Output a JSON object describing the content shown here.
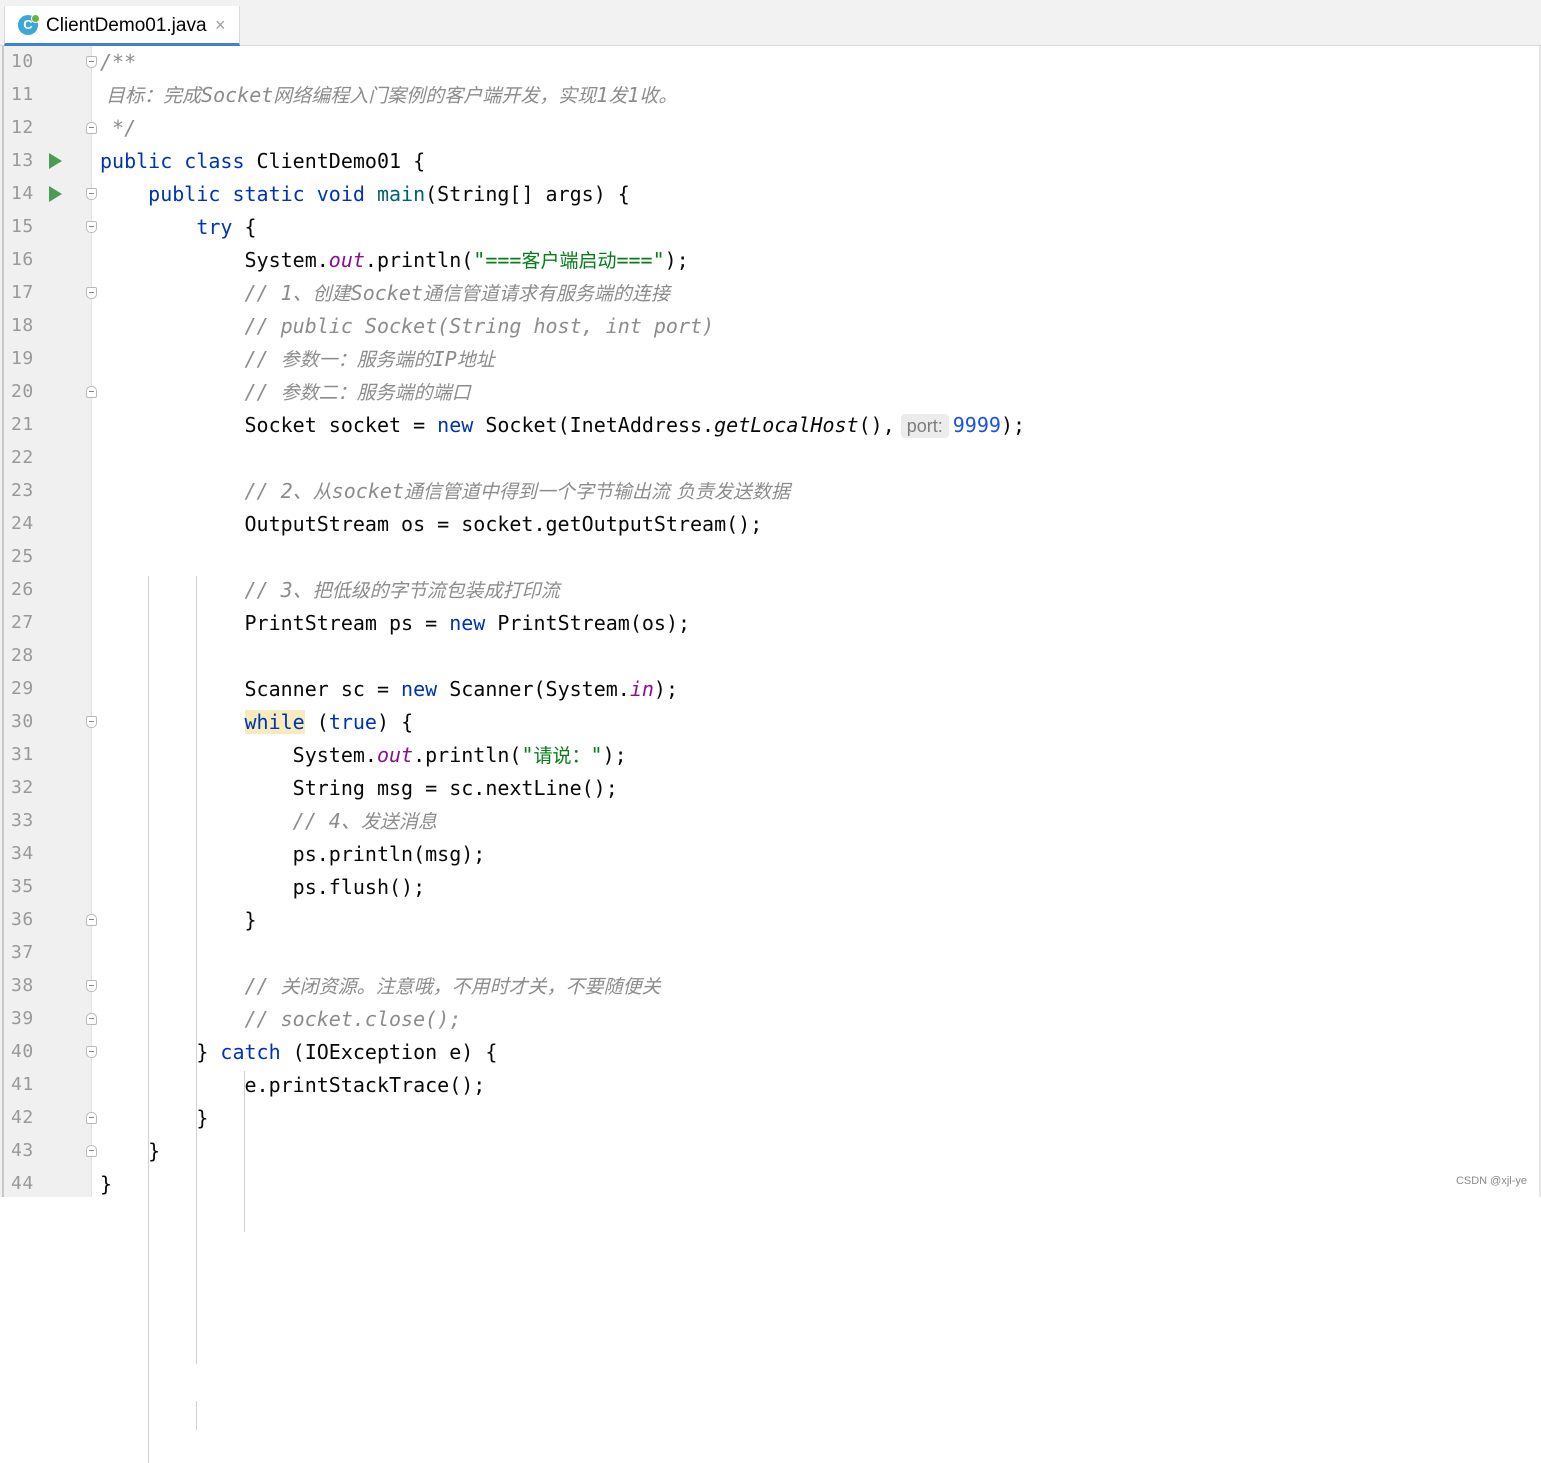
{
  "tab": {
    "icon_letter": "C",
    "title": "ClientDemo01.java",
    "close_glyph": "×"
  },
  "editor": {
    "line_numbers": [
      "10",
      "11",
      "12",
      "13",
      "14",
      "15",
      "16",
      "17",
      "18",
      "19",
      "20",
      "21",
      "22",
      "23",
      "24",
      "25",
      "26",
      "27",
      "28",
      "29",
      "30",
      "31",
      "32",
      "33",
      "34",
      "35",
      "36",
      "37",
      "38",
      "39",
      "40",
      "41",
      "42",
      "43",
      "44"
    ],
    "lines": [
      [
        {
          "t": "/**",
          "c": "cm"
        }
      ],
      [
        {
          "t": " 目标：完成",
          "c": "cm cjk"
        },
        {
          "t": "Socket",
          "c": "cm"
        },
        {
          "t": "网络编程入门案例的客户端开发，实现",
          "c": "cm cjk"
        },
        {
          "t": "1",
          "c": "cm"
        },
        {
          "t": "发",
          "c": "cm cjk"
        },
        {
          "t": "1",
          "c": "cm"
        },
        {
          "t": "收。",
          "c": "cm cjk"
        }
      ],
      [
        {
          "t": " */",
          "c": "cm"
        }
      ],
      [
        {
          "t": "public class ",
          "c": "kw"
        },
        {
          "t": "ClientDemo01 {"
        }
      ],
      [
        {
          "t": "    public static void ",
          "c": "kw"
        },
        {
          "t": "main",
          "c": "fn"
        },
        {
          "t": "(String[] args) {"
        }
      ],
      [
        {
          "t": "        "
        },
        {
          "t": "try",
          "c": "kw"
        },
        {
          "t": " {"
        }
      ],
      [
        {
          "t": "            System."
        },
        {
          "t": "out",
          "c": "fld"
        },
        {
          "t": ".println("
        },
        {
          "t": "\"===",
          "c": "str"
        },
        {
          "t": "客户端启动",
          "c": "str cjk"
        },
        {
          "t": "===\"",
          "c": "str"
        },
        {
          "t": ");"
        }
      ],
      [
        {
          "t": "            // 1、",
          "c": "cm"
        },
        {
          "t": "创建",
          "c": "cm cjk"
        },
        {
          "t": "Socket",
          "c": "cm"
        },
        {
          "t": "通信管道请求有服务端的连接",
          "c": "cm cjk"
        }
      ],
      [
        {
          "t": "            // public Socket(String host, int port)",
          "c": "cm"
        }
      ],
      [
        {
          "t": "            // ",
          "c": "cm"
        },
        {
          "t": "参数一：服务端的",
          "c": "cm cjk"
        },
        {
          "t": "IP",
          "c": "cm"
        },
        {
          "t": "地址",
          "c": "cm cjk"
        }
      ],
      [
        {
          "t": "            // ",
          "c": "cm"
        },
        {
          "t": "参数二：服务端的端口",
          "c": "cm cjk"
        }
      ],
      [
        {
          "t": "            Socket socket = "
        },
        {
          "t": "new",
          "c": "kw"
        },
        {
          "t": " Socket(InetAddress."
        },
        {
          "t": "getLocalHost",
          "c": "st"
        },
        {
          "t": "(),"
        },
        {
          "t": "port:",
          "c": "hint"
        },
        {
          "t": "9999",
          "c": "num"
        },
        {
          "t": ");"
        }
      ],
      [],
      [
        {
          "t": "            // 2、",
          "c": "cm"
        },
        {
          "t": "从",
          "c": "cm cjk"
        },
        {
          "t": "socket",
          "c": "cm"
        },
        {
          "t": "通信管道中得到一个字节输出流 负责发送数据",
          "c": "cm cjk"
        }
      ],
      [
        {
          "t": "            OutputStream os = socket.getOutputStream();"
        }
      ],
      [],
      [
        {
          "t": "            // 3、",
          "c": "cm"
        },
        {
          "t": "把低级的字节流包装成打印流",
          "c": "cm cjk"
        }
      ],
      [
        {
          "t": "            PrintStream ps = "
        },
        {
          "t": "new",
          "c": "kw"
        },
        {
          "t": " PrintStream(os);"
        }
      ],
      [],
      [
        {
          "t": "            Scanner sc = "
        },
        {
          "t": "new",
          "c": "kw"
        },
        {
          "t": " Scanner(System."
        },
        {
          "t": "in",
          "c": "fld"
        },
        {
          "t": ");"
        }
      ],
      [
        {
          "t": "            "
        },
        {
          "t": "while",
          "c": "kw hl"
        },
        {
          "t": " ("
        },
        {
          "t": "true",
          "c": "kw"
        },
        {
          "t": ") {"
        }
      ],
      [
        {
          "t": "                System."
        },
        {
          "t": "out",
          "c": "fld"
        },
        {
          "t": ".println("
        },
        {
          "t": "\"",
          "c": "str"
        },
        {
          "t": "请说：",
          "c": "str cjk"
        },
        {
          "t": "\"",
          "c": "str"
        },
        {
          "t": ");"
        }
      ],
      [
        {
          "t": "                String msg = sc.nextLine();"
        }
      ],
      [
        {
          "t": "                // 4、",
          "c": "cm"
        },
        {
          "t": "发送消息",
          "c": "cm cjk"
        }
      ],
      [
        {
          "t": "                ps.println(msg);"
        }
      ],
      [
        {
          "t": "                ps.flush();"
        }
      ],
      [
        {
          "t": "            }"
        }
      ],
      [],
      [
        {
          "t": "            // ",
          "c": "cm"
        },
        {
          "t": "关闭资源。注意哦，不用时才关，不要随便关",
          "c": "cm cjk"
        }
      ],
      [
        {
          "t": "            // socket.close();",
          "c": "cm"
        }
      ],
      [
        {
          "t": "        } "
        },
        {
          "t": "catch",
          "c": "kw"
        },
        {
          "t": " (IOException e) {"
        }
      ],
      [
        {
          "t": "            e.printStackTrace();"
        }
      ],
      [
        {
          "t": "        }"
        }
      ],
      [
        {
          "t": "    }"
        }
      ],
      [
        {
          "t": "}"
        }
      ]
    ],
    "run_gutter_lines": [
      "13",
      "14"
    ],
    "fold_markers": [
      {
        "line": "10",
        "kind": "start"
      },
      {
        "line": "12",
        "kind": "end"
      },
      {
        "line": "14",
        "kind": "start"
      },
      {
        "line": "15",
        "kind": "start"
      },
      {
        "line": "17",
        "kind": "start"
      },
      {
        "line": "20",
        "kind": "end"
      },
      {
        "line": "30",
        "kind": "start"
      },
      {
        "line": "36",
        "kind": "end"
      },
      {
        "line": "38",
        "kind": "start"
      },
      {
        "line": "39",
        "kind": "end"
      },
      {
        "line": "40",
        "kind": "start"
      },
      {
        "line": "42",
        "kind": "end"
      },
      {
        "line": "43",
        "kind": "end"
      }
    ]
  },
  "watermark": "CSDN @xjl-ye",
  "colors": {
    "keyword": "#0033b3",
    "method_declaration": "#00627a",
    "static_field": "#871094",
    "string": "#067d17",
    "number": "#1750eb",
    "comment": "#8c8c8c",
    "run_icon": "#499c54",
    "tab_underline": "#4083c9",
    "highlight": "#f6ebbc"
  }
}
